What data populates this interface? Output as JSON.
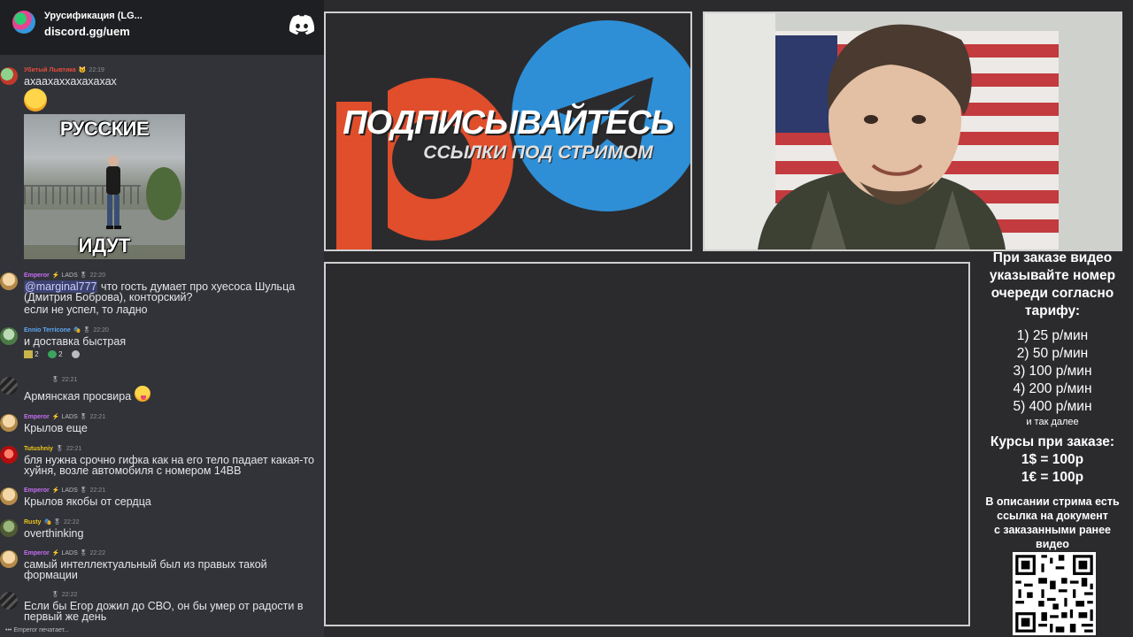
{
  "discord": {
    "server_name": "Урусификация (LG...",
    "invite_link": "discord.gg/uem",
    "messages": [
      {
        "user": "Убитый Лывтика",
        "badge": "🐱",
        "time": "22:19",
        "text": "ахаахаххахахахах"
      },
      {
        "gif_caption_top": "РУССКИЕ",
        "gif_caption_bottom": "ИДУТ"
      },
      {
        "user": "Emperor",
        "badge": "⚡ LADS 🎖",
        "time": "22:20",
        "mention": "@marginal777",
        "text": " что гость думает про хуесоса Шульца (Дмитрия Боброва), конторский?",
        "text2": "если не успел, то ладно"
      },
      {
        "user": "Ennio Terricone",
        "badge": "🎭 🎖",
        "time": "22:20",
        "text": "и доставка быстрая",
        "reaction1_count": "2",
        "reaction2_count": "2"
      },
      {
        "user": "",
        "badge": "🎖",
        "time": "22:21",
        "text": "Армянская просвира"
      },
      {
        "user": "Emperor",
        "badge": "⚡ LADS 🎖",
        "time": "22:21",
        "text": "Крылов еще"
      },
      {
        "user": "Tutushniy",
        "badge": "🎖",
        "time": "22:21",
        "text": "бля нужна срочно гифка как на его тело падает какая-то хуйня, возле автомобиля с номером 14BB"
      },
      {
        "user": "Emperor",
        "badge": "⚡ LADS 🎖",
        "time": "22:21",
        "text": "Крылов якобы от сердца"
      },
      {
        "user": "Rusty",
        "badge": "🎭 🎖",
        "time": "22:22",
        "text": "overthinking"
      },
      {
        "user": "Emperor",
        "badge": "⚡ LADS 🎖",
        "time": "22:22",
        "text": "самый интеллектуальный был из правых такой формации"
      },
      {
        "user": "",
        "badge": "🎖",
        "time": "22:22",
        "text": "Если бы Егор дожил до СВО, он бы умер от радости в первый же день"
      }
    ],
    "typing": "Emperor печатает..."
  },
  "promo": {
    "headline": "ПОДПИСЫВАЙТЕСЬ",
    "subline": "ССЫЛКИ ПОД СТРИМОМ"
  },
  "info": {
    "heading": [
      "При заказе видео",
      "указывайте номер",
      "очереди согласно",
      "тарифу:"
    ],
    "prices": [
      "1) 25 р/мин",
      "2) 50 р/мин",
      "3) 100 р/мин",
      "4) 200 р/мин",
      "5) 400 р/мин"
    ],
    "and_so_on": "и так далее",
    "rates_title": "Курсы при заказе:",
    "rates": [
      "1$ = 100р",
      "1€ = 100р"
    ],
    "description": [
      "В описании стрима есть",
      "ссылка на документ",
      "с заказанными ранее",
      "видео"
    ]
  },
  "colors": {
    "accent_orange": "#e04e2b",
    "accent_telegram": "#2e8fd6",
    "username_red": "#e74c3c",
    "username_purple": "#c86df5",
    "username_blue": "#5da9f5",
    "username_yellow": "#f0c419"
  }
}
